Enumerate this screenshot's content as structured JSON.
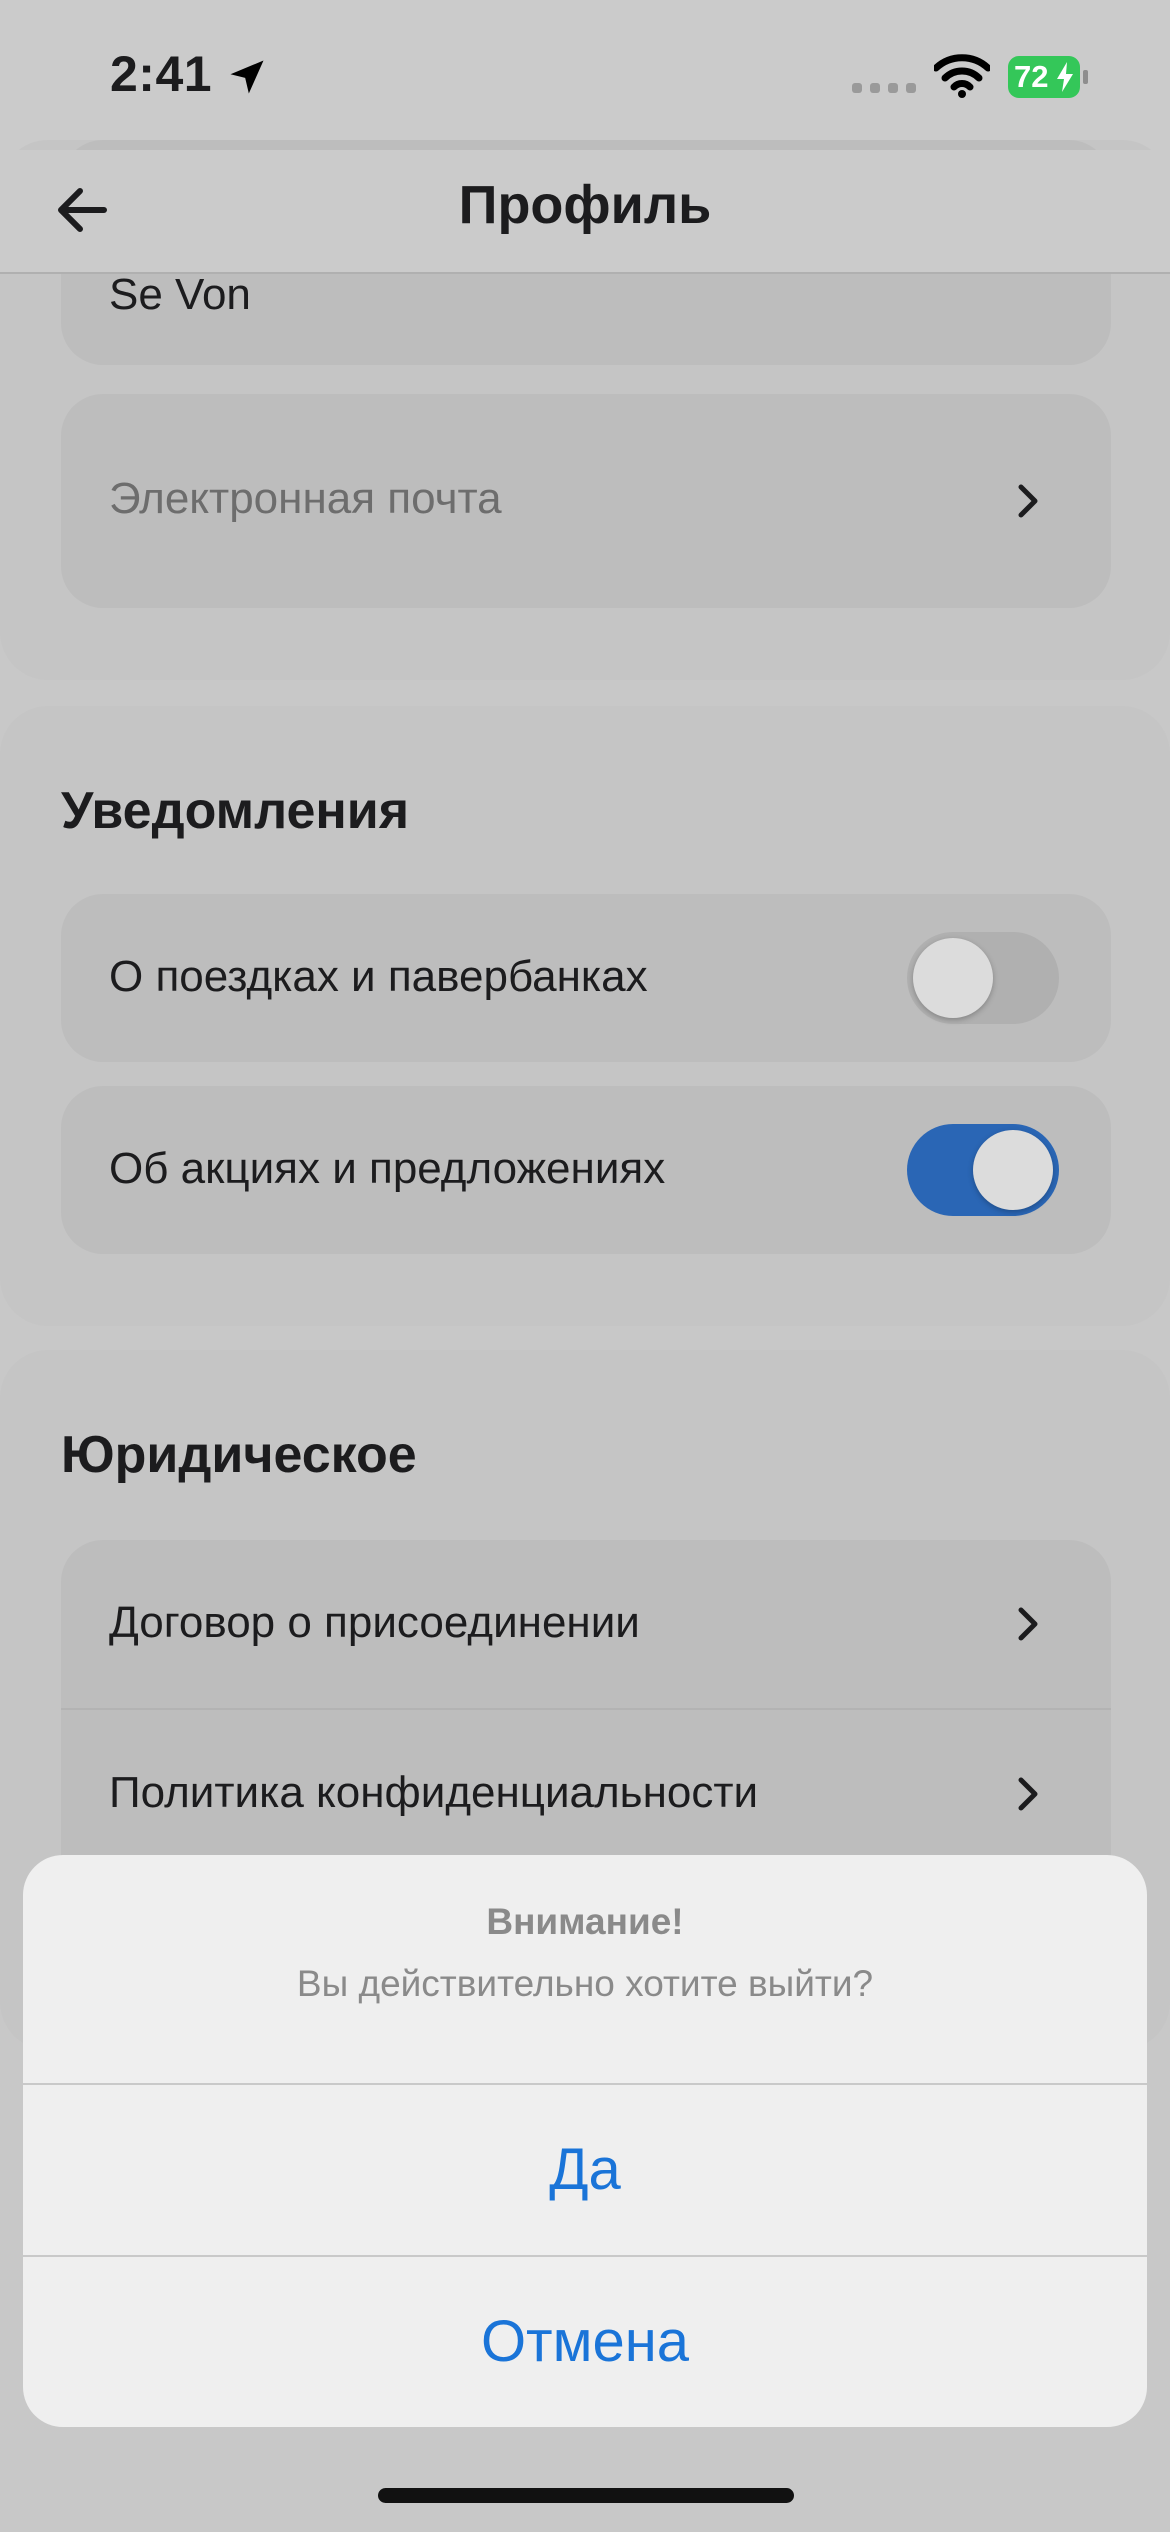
{
  "status_bar": {
    "time": "2:41",
    "battery": "72",
    "battery_color": "#34c759"
  },
  "nav": {
    "title": "Профиль",
    "back_icon": "arrow-left-icon"
  },
  "account": {
    "name_value": "Se Von",
    "email_placeholder": "Электронная почта"
  },
  "notifications": {
    "title": "Уведомления",
    "items": [
      {
        "label": "О поездках и павербанках",
        "enabled": false
      },
      {
        "label": "Об акциях и предложениях",
        "enabled": true
      }
    ]
  },
  "legal": {
    "title": "Юридическое",
    "items": [
      {
        "label": "Договор о присоединении"
      },
      {
        "label": "Политика конфиденциальности"
      }
    ]
  },
  "alert": {
    "title": "Внимание!",
    "message": "Вы действительно хотите выйти?",
    "confirm_label": "Да",
    "cancel_label": "Отмена",
    "button_color": "#1a74d8"
  }
}
